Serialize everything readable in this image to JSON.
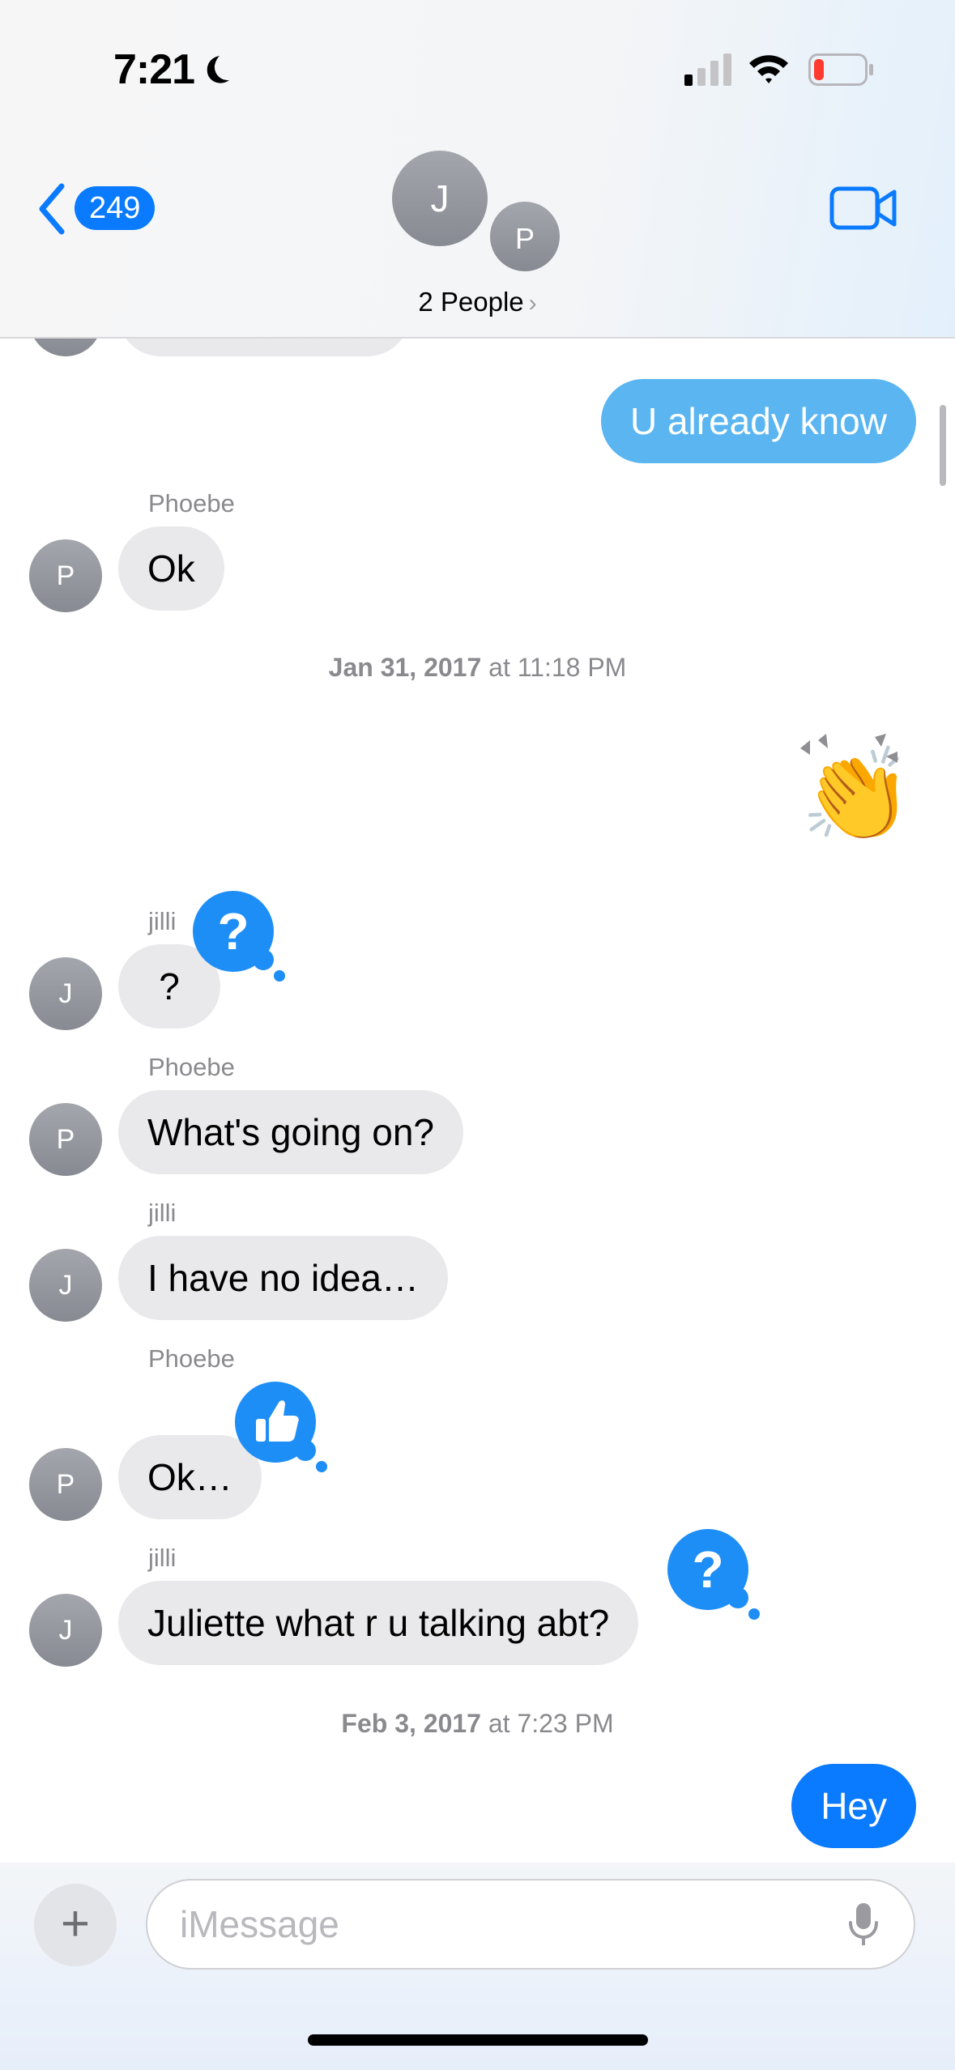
{
  "status_bar": {
    "time": "7:21"
  },
  "header": {
    "back_count": "249",
    "avatar_j": "J",
    "avatar_p": "P",
    "group_label": "2 People",
    "group_chevron": "›"
  },
  "messages": [
    {
      "type": "outgoing-sms",
      "text": "U already know"
    },
    {
      "type": "incoming",
      "sender": "Phoebe",
      "avatar": "P",
      "text": "Ok"
    },
    {
      "type": "timestamp",
      "date": "Jan 31, 2017",
      "time": " at 11:18 PM"
    },
    {
      "type": "outgoing-emoji",
      "text": "👏"
    },
    {
      "type": "incoming",
      "sender": "jilli",
      "avatar": "J",
      "text": "?",
      "tapback": "question-mark-icon"
    },
    {
      "type": "incoming",
      "sender": "Phoebe",
      "avatar": "P",
      "text": "What's going on?"
    },
    {
      "type": "incoming",
      "sender": "jilli",
      "avatar": "J",
      "text": "I have no idea…"
    },
    {
      "type": "incoming",
      "sender": "Phoebe",
      "avatar": "P",
      "text": "Ok…",
      "tapback": "thumbs-up-icon"
    },
    {
      "type": "incoming",
      "sender": "jilli",
      "avatar": "J",
      "text": "Juliette what r u talking abt?",
      "tapback": "question-mark-icon"
    },
    {
      "type": "timestamp",
      "date": "Feb 3, 2017",
      "time": " at 7:23 PM"
    },
    {
      "type": "outgoing-imessage",
      "text": "Hey"
    }
  ],
  "tapback_glyphs": {
    "question": "?"
  },
  "input": {
    "placeholder": "iMessage",
    "plus": "+"
  },
  "colors": {
    "imessage_blue": "#0a7aff",
    "sms_blue": "#5ab5f1",
    "incoming_gray": "#e9e9eb",
    "tapback_blue": "#1e8ef7",
    "battery_low_red": "#ff3b30"
  }
}
